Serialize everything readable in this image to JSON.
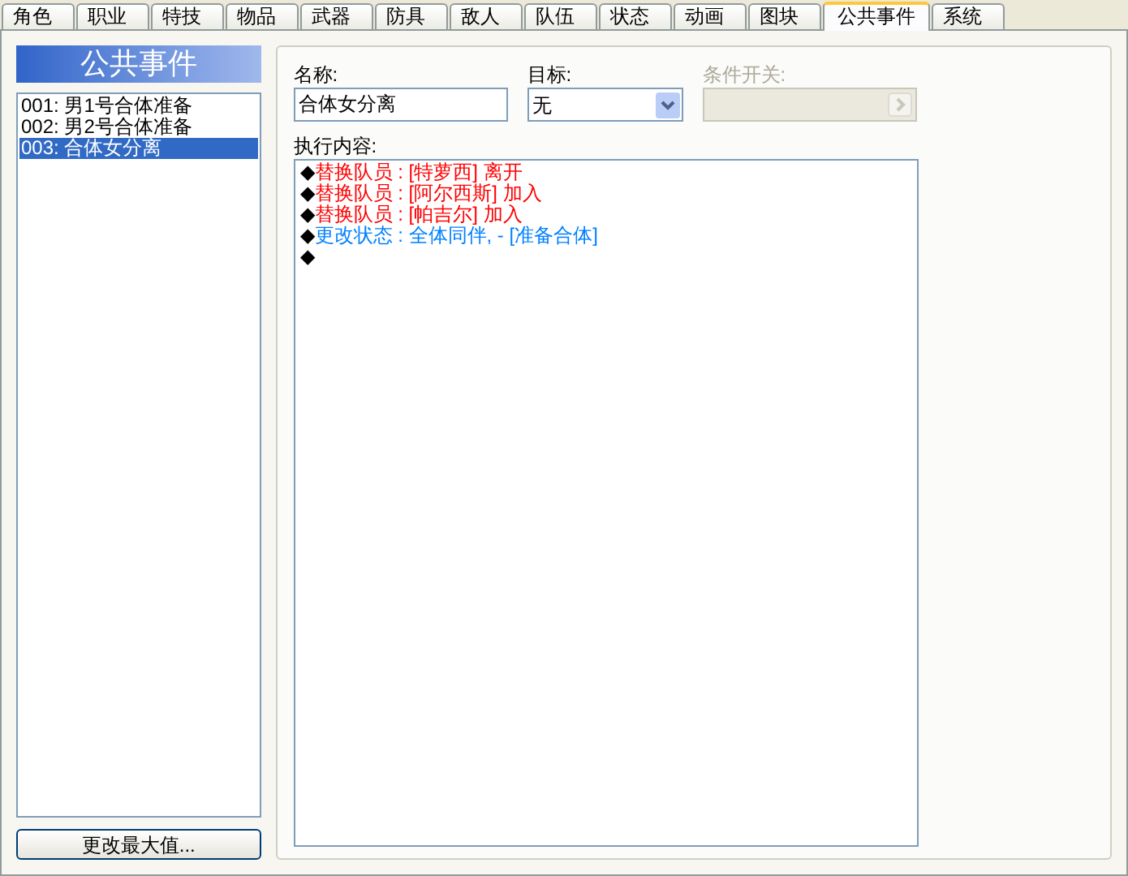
{
  "tabs": [
    {
      "label": "角色",
      "selected": false
    },
    {
      "label": "职业",
      "selected": false
    },
    {
      "label": "特技",
      "selected": false
    },
    {
      "label": "物品",
      "selected": false
    },
    {
      "label": "武器",
      "selected": false
    },
    {
      "label": "防具",
      "selected": false
    },
    {
      "label": "敌人",
      "selected": false
    },
    {
      "label": "队伍",
      "selected": false
    },
    {
      "label": "状态",
      "selected": false
    },
    {
      "label": "动画",
      "selected": false
    },
    {
      "label": "图块",
      "selected": false
    },
    {
      "label": "公共事件",
      "selected": true
    },
    {
      "label": "系统",
      "selected": false
    }
  ],
  "sidebar": {
    "title": "公共事件",
    "items": [
      {
        "number": "001:",
        "name": "男1号合体准备",
        "selected": false
      },
      {
        "number": "002:",
        "name": "男2号合体准备",
        "selected": false
      },
      {
        "number": "003:",
        "name": "合体女分离",
        "selected": true
      }
    ],
    "button": "更改最大值..."
  },
  "form": {
    "name_label": "名称:",
    "name_value": "合体女分离",
    "target_label": "目标:",
    "target_value": "无",
    "switch_label": "条件开关:",
    "switch_disabled": true,
    "content_label": "执行内容:",
    "commands": [
      {
        "marker": "◆",
        "text": "替换队员 : [特萝西] 离开",
        "color": "#ff0000"
      },
      {
        "marker": "◆",
        "text": "替换队员 : [阿尔西斯] 加入",
        "color": "#ff0000"
      },
      {
        "marker": "◆",
        "text": "替换队员 : [帕吉尔] 加入",
        "color": "#ff0000"
      },
      {
        "marker": "◆",
        "text": "更改状态 : 全体同伴, - [准备合体]",
        "color": "#0080ff"
      },
      {
        "marker": "◆"
      }
    ]
  }
}
